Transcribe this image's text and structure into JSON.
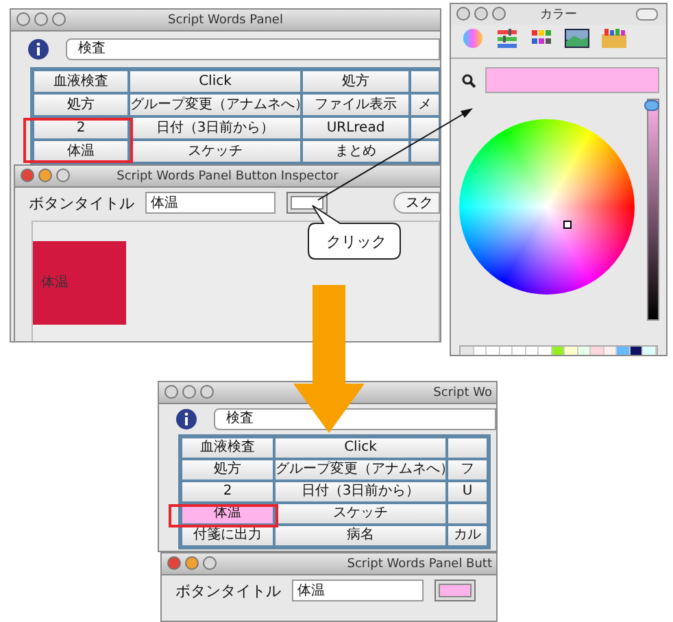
{
  "top_window": {
    "title": "Script Words Panel",
    "category": "検査",
    "grid": [
      [
        {
          "text": "血液検査"
        },
        {
          "text": "Click"
        },
        {
          "text": "処方"
        }
      ],
      [
        {
          "text": "処方"
        },
        {
          "text": "グループ変更（アナムネへ）"
        },
        {
          "text": "ファイル表示"
        },
        {
          "text": "メ"
        }
      ],
      [
        {
          "text": "2"
        },
        {
          "text": "日付（3日前から）"
        },
        {
          "text": "URLread"
        }
      ],
      [
        {
          "text": "体温"
        },
        {
          "text": "スケッチ"
        },
        {
          "text": "まとめ"
        }
      ]
    ],
    "inspector": {
      "title": "Script Words Panel Button Inspector",
      "label": "ボタンタイトル",
      "value": "体温",
      "color_well": {
        "color": "#ffffff"
      },
      "button": "スク",
      "preview": {
        "text": "体温",
        "color": "#d2183f"
      }
    }
  },
  "callout": "クリック",
  "color_panel": {
    "title": "カラー",
    "current_color": {
      "color": "#ffb3ea"
    },
    "brightness": {
      "level": 1
    },
    "swatches": [
      {
        "color": "#e6e6e6"
      },
      {
        "color": "#ffffff"
      },
      {
        "color": "#ffffff"
      },
      {
        "color": "#ffffff"
      },
      {
        "color": "#ffffff"
      },
      {
        "color": "#ffffff"
      },
      {
        "color": "#ffffff"
      },
      {
        "color": "#99ee22"
      },
      {
        "color": "#ffffcc"
      },
      {
        "color": "#e6ffe6"
      },
      {
        "color": "#ffd6de"
      },
      {
        "color": "#fff0f0"
      },
      {
        "color": "#66bbff"
      },
      {
        "color": "#111166"
      },
      {
        "color": "#dffff6"
      }
    ]
  },
  "bottom_window": {
    "title": "Script Wo",
    "category": "検査",
    "grid": [
      [
        {
          "text": "血液検査"
        },
        {
          "text": "Click"
        }
      ],
      [
        {
          "text": "処方"
        },
        {
          "text": "グループ変更（アナムネへ）"
        },
        {
          "text": "フ"
        }
      ],
      [
        {
          "text": "2"
        },
        {
          "text": "日付（3日前から）"
        },
        {
          "text": "U"
        }
      ],
      [
        {
          "text": "体温",
          "color": "#ffb3ea"
        },
        {
          "text": "スケッチ"
        }
      ],
      [
        {
          "text": "付箋に出力"
        },
        {
          "text": "病名"
        },
        {
          "text": "カル"
        }
      ]
    ],
    "inspector": {
      "title": "Script Words Panel Butt",
      "label": "ボタンタイトル",
      "value": "体温",
      "color_well": {
        "color": "#ffb3ea"
      }
    }
  }
}
